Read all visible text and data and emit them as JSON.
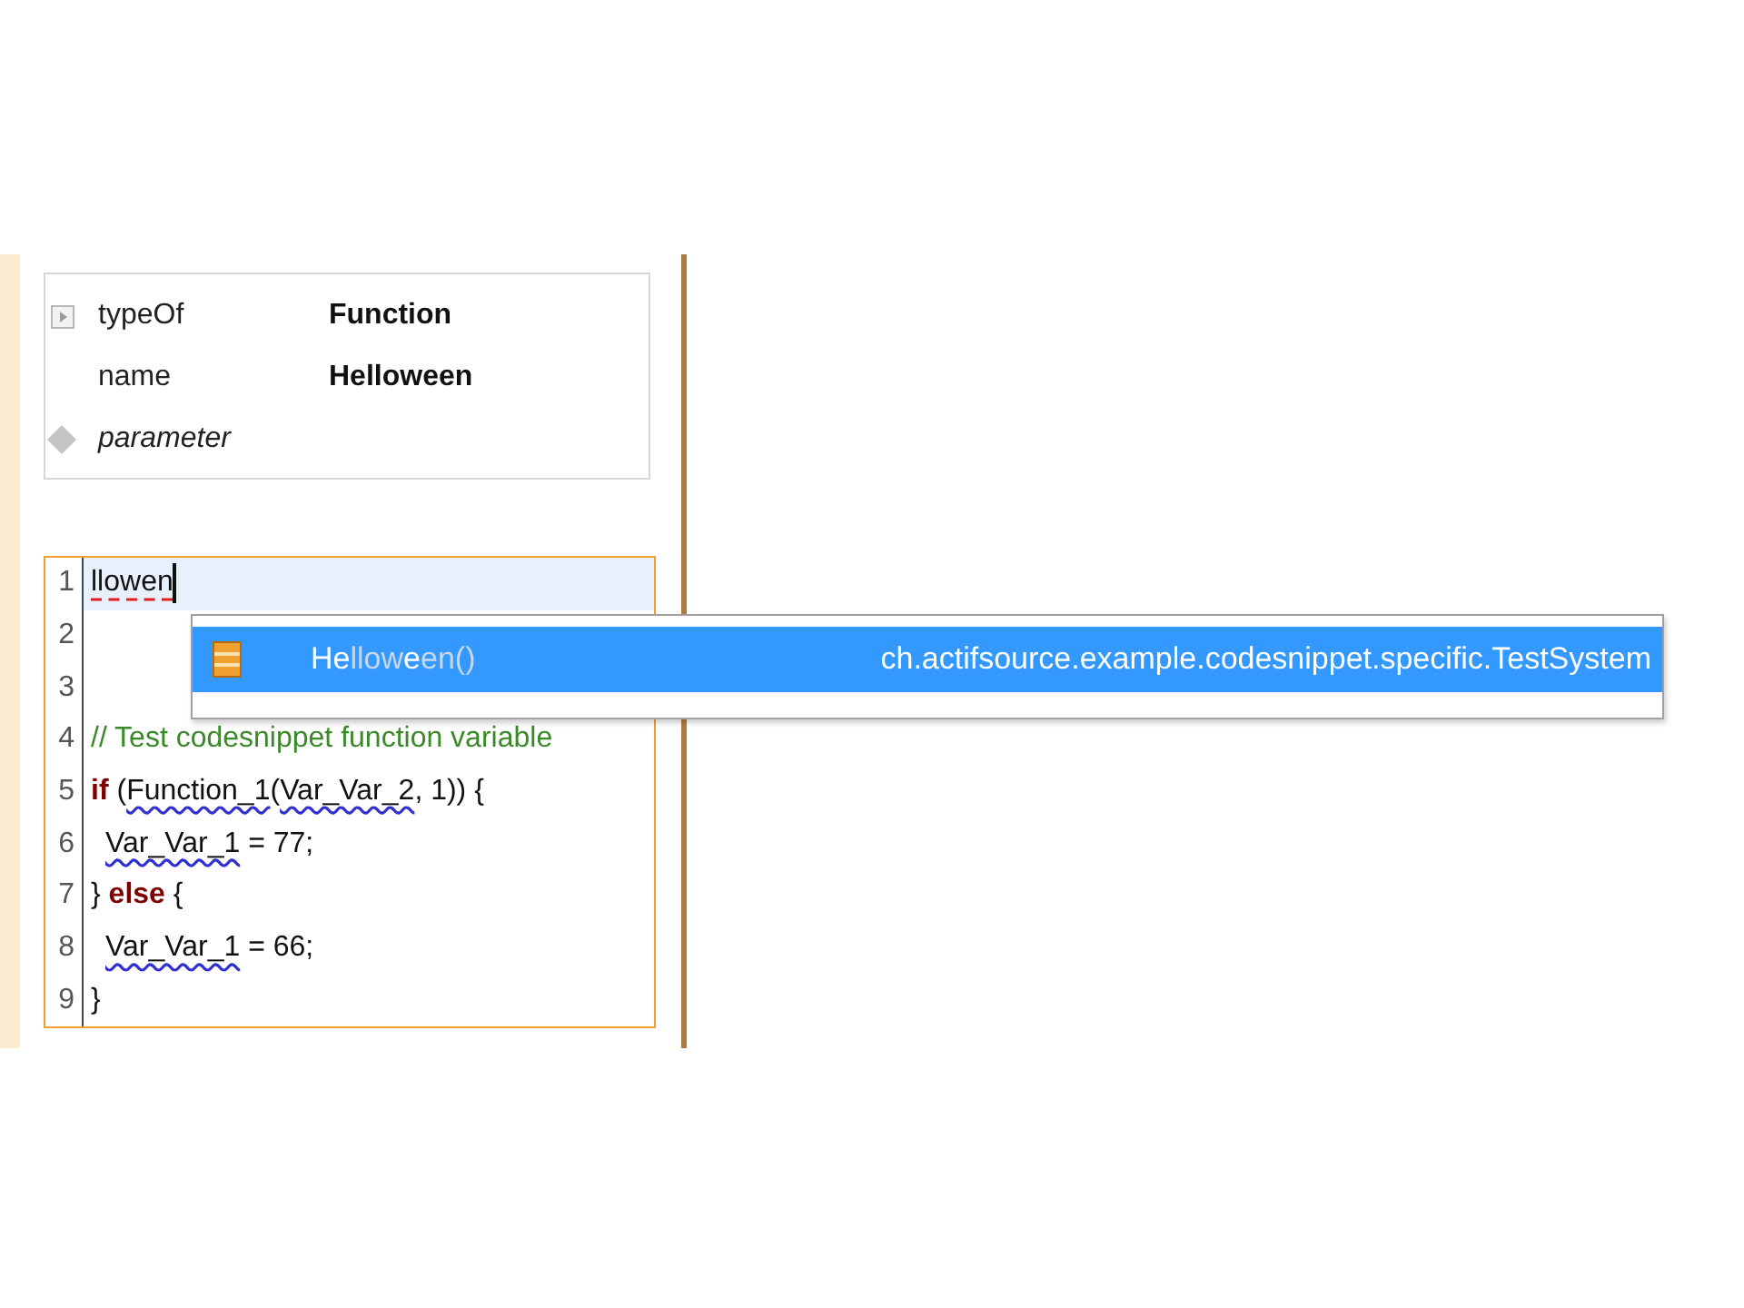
{
  "properties": [
    {
      "label": "typeOf",
      "value": "Function",
      "kind": "reference"
    },
    {
      "label": "name",
      "value": "Helloween",
      "kind": "attribute"
    },
    {
      "label": "parameter",
      "kind": "list"
    }
  ],
  "editor": {
    "lines": [
      {
        "number": "1",
        "current": true,
        "indent": false,
        "tokens": [
          {
            "text": "llowen",
            "kind": "error"
          }
        ]
      },
      {
        "number": "2",
        "current": false
      },
      {
        "number": "3",
        "current": false
      },
      {
        "number": "4",
        "current": false,
        "indent": false,
        "tokens": [
          {
            "text": "// Test codesnippet function variable",
            "kind": "comment"
          }
        ]
      },
      {
        "number": "5",
        "current": false,
        "indent": false,
        "tokens": [
          {
            "text": "if",
            "kind": "keyword"
          },
          {
            "text": " (",
            "kind": "plain"
          },
          {
            "text": "Function_1",
            "kind": "reference"
          },
          {
            "text": "(",
            "kind": "plain"
          },
          {
            "text": "Var_Var_2",
            "kind": "reference"
          },
          {
            "text": ", 1)) {",
            "kind": "plain"
          }
        ]
      },
      {
        "number": "6",
        "current": false,
        "indent": true,
        "tokens": [
          {
            "text": "Var_Var_1",
            "kind": "reference"
          },
          {
            "text": " = 77;",
            "kind": "plain"
          }
        ]
      },
      {
        "number": "7",
        "current": false,
        "indent": false,
        "tokens": [
          {
            "text": "} ",
            "kind": "plain"
          },
          {
            "text": "else",
            "kind": "keyword"
          },
          {
            "text": " {",
            "kind": "plain"
          }
        ]
      },
      {
        "number": "8",
        "current": false,
        "indent": true,
        "tokens": [
          {
            "text": "Var_Var_1",
            "kind": "reference"
          },
          {
            "text": " = 66;",
            "kind": "plain"
          }
        ]
      },
      {
        "number": "9",
        "current": false,
        "indent": false,
        "tokens": [
          {
            "text": "}",
            "kind": "plain"
          }
        ]
      }
    ]
  },
  "completion": {
    "items": [
      {
        "selected": true,
        "parts": [
          {
            "text": "He",
            "match": true
          },
          {
            "text": "llow",
            "match": false
          },
          {
            "text": "e",
            "match": true
          },
          {
            "text": "en()",
            "match": false
          }
        ],
        "qualifier": "ch.actifsource.example.codesnippet.specific.TestSystem"
      }
    ]
  }
}
